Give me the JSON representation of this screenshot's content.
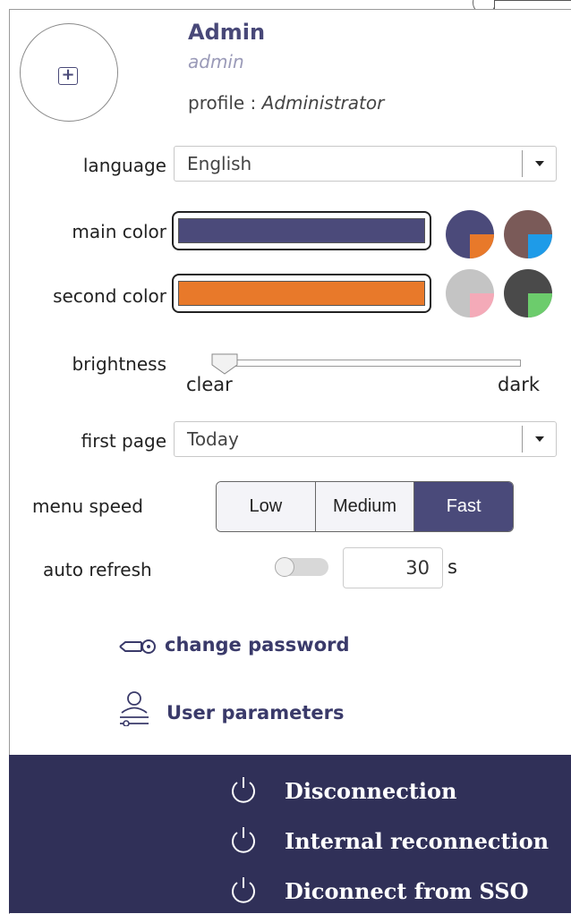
{
  "user": {
    "name": "Admin",
    "login": "admin",
    "profile_label": "profile : ",
    "profile_value": "Administrator"
  },
  "tooltip": "User parameters",
  "form": {
    "language_label": "language",
    "language_value": "English",
    "main_color_label": "main color",
    "main_color_value": "#4b4a7a",
    "second_color_label": "second color",
    "second_color_value": "#e8792a",
    "brightness_label": "brightness",
    "brightness_min": "clear",
    "brightness_max": "dark",
    "brightness_level": 0.03,
    "first_page_label": "first page",
    "first_page_value": "Today",
    "menu_speed_label": "menu speed",
    "menu_speed_options": [
      "Low",
      "Medium",
      "Fast"
    ],
    "menu_speed_selected": "Fast",
    "auto_refresh_label": "auto refresh",
    "auto_refresh_enabled": false,
    "auto_refresh_value": "30",
    "auto_refresh_unit": "s"
  },
  "swatches": [
    {
      "name": "navy-orange",
      "base": "#4b4a7a",
      "accent": "#e8792a"
    },
    {
      "name": "brown-blue",
      "base": "#7a5a58",
      "accent": "#1e9be8"
    },
    {
      "name": "grey-pink",
      "base": "#c4c4c4",
      "accent": "#f4aab8"
    },
    {
      "name": "dark-green",
      "base": "#4a4a4a",
      "accent": "#6ccc6c"
    }
  ],
  "links": {
    "change_password": "change password",
    "user_parameters": "User parameters"
  },
  "footer": {
    "disconnection": "Disconnection",
    "internal_reconnection": "Internal reconnection",
    "disconnect_sso": "Diconnect from SSO"
  },
  "colors": {
    "footer_bg": "#303058",
    "accent": "#4a4a7a",
    "text_primary": "#484878"
  }
}
